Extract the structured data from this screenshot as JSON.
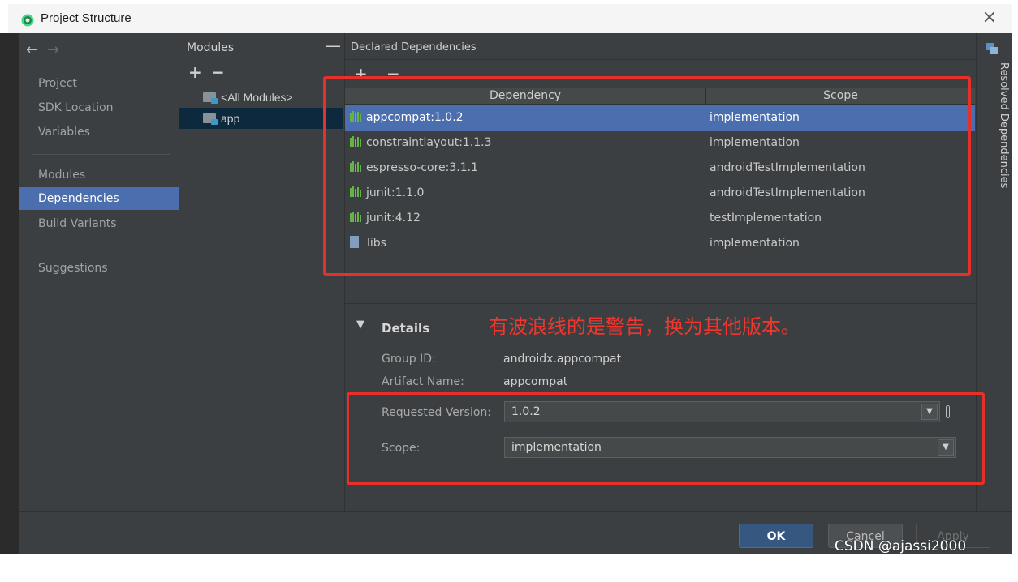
{
  "window": {
    "title": "Project Structure",
    "close_glyph": "×"
  },
  "nav": {
    "back_glyph": "←",
    "forward_glyph": "→",
    "group1": [
      "Project",
      "SDK Location",
      "Variables"
    ],
    "group2": [
      "Modules",
      "Dependencies",
      "Build Variants"
    ],
    "group3": [
      "Suggestions"
    ],
    "active": "Dependencies"
  },
  "modules_panel": {
    "header": "Modules",
    "collapse_glyph": "—",
    "add_glyph": "+",
    "remove_glyph": "−",
    "items": [
      "<All Modules>",
      "app"
    ],
    "selected": "app"
  },
  "dependencies_panel": {
    "header": "Declared Dependencies",
    "add_glyph": "+",
    "remove_glyph": "−",
    "columns": {
      "dependency": "Dependency",
      "scope": "Scope"
    },
    "rows": [
      {
        "name": "appcompat:1.0.2",
        "scope": "implementation",
        "icon": "library-icon"
      },
      {
        "name": "constraintlayout:1.1.3",
        "scope": "implementation",
        "icon": "library-icon"
      },
      {
        "name": "espresso-core:3.1.1",
        "scope": "androidTestImplementation",
        "icon": "library-icon"
      },
      {
        "name": "junit:1.1.0",
        "scope": "androidTestImplementation",
        "icon": "library-icon"
      },
      {
        "name": "junit:4.12",
        "scope": "testImplementation",
        "icon": "library-icon"
      },
      {
        "name": "libs",
        "scope": "implementation",
        "icon": "jar-file-icon"
      }
    ],
    "selected_row": 0
  },
  "details": {
    "toggle_glyph": "▼",
    "label": "Details",
    "annotation": "有波浪线的是警告，换为其他版本。",
    "group_id_label": "Group ID:",
    "group_id_value": "androidx.appcompat",
    "artifact_label": "Artifact Name:",
    "artifact_value": "appcompat",
    "requested_version_label": "Requested Version:",
    "requested_version_value": "1.0.2",
    "scope_label": "Scope:",
    "scope_value": "implementation",
    "dropdown_glyph": "▼"
  },
  "side_tool": {
    "label": "Resolved Dependencies"
  },
  "footer": {
    "ok": "OK",
    "cancel": "Cancel",
    "apply": "Apply"
  },
  "watermark": "CSDN @ajassi2000",
  "colors": {
    "background": "#3c3f41",
    "selection": "#4b6eaf",
    "annotation_red": "#e8302a",
    "ok_button": "#365880"
  }
}
